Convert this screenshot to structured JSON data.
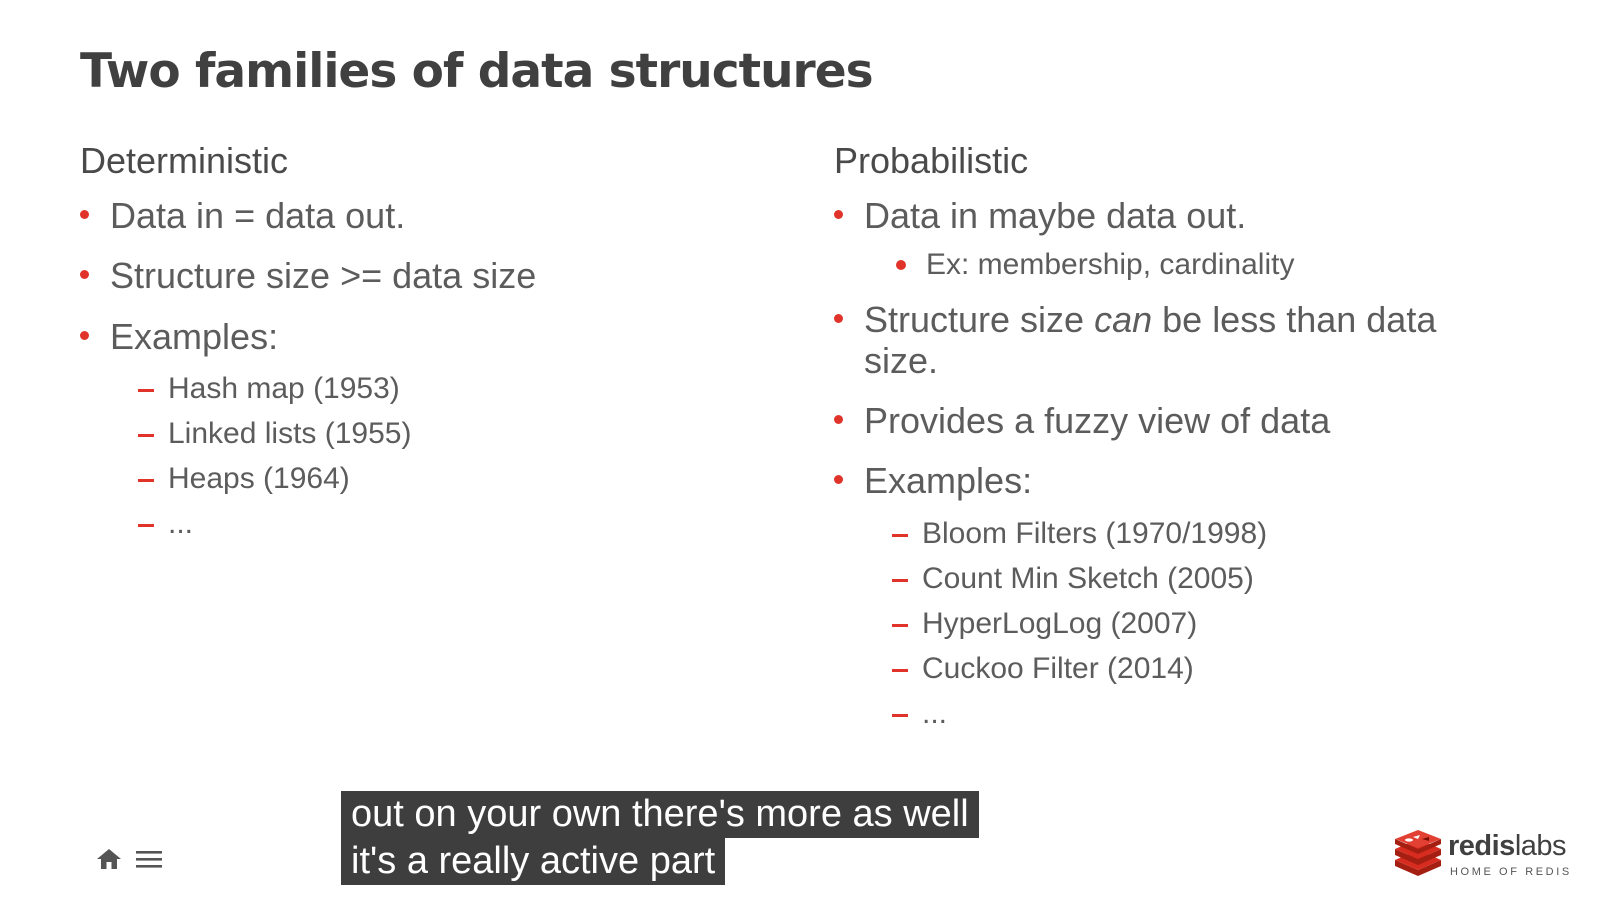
{
  "slide": {
    "title": "Two families of data structures",
    "accent_color": "#e0342b",
    "left": {
      "heading": "Deterministic",
      "bullets": [
        "Data in = data out.",
        "Structure size >= data size",
        "Examples:"
      ],
      "examples": [
        "Hash map (1953)",
        "Linked lists (1955)",
        "Heaps (1964)",
        "..."
      ]
    },
    "right": {
      "heading": "Probabilistic",
      "bullet1": "Data in maybe data out.",
      "sub_bullet": "Ex: membership, cardinality",
      "bullet2_before": "Structure size ",
      "bullet2_italic": "can",
      "bullet2_after": " be less than data size.",
      "bullet3": "Provides a fuzzy view of data",
      "bullet4": "Examples:",
      "examples": [
        "Bloom Filters (1970/1998)",
        "Count Min Sketch (2005)",
        "HyperLogLog (2007)",
        "Cuckoo Filter (2014)",
        "..."
      ]
    }
  },
  "caption": {
    "line1": "out on your own there's more as well",
    "line2": "it's a really active part"
  },
  "nav": {
    "home_icon": "home-icon",
    "menu_icon": "menu-icon"
  },
  "logo": {
    "name_bold": "redis",
    "name_light": "labs",
    "tagline": "HOME OF REDIS"
  }
}
